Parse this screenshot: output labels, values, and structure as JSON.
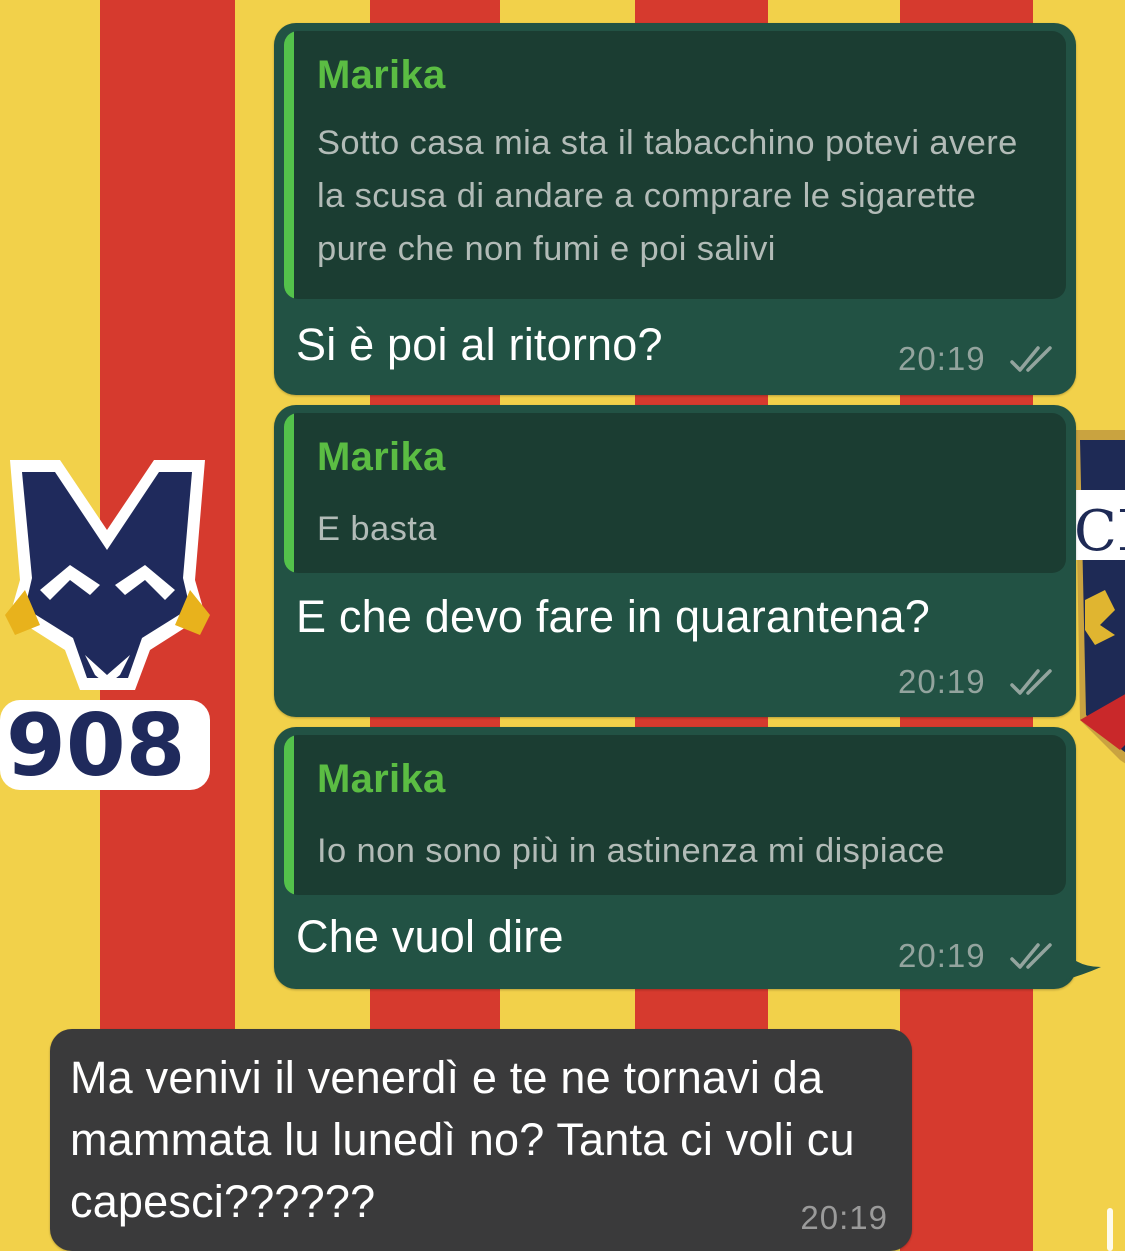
{
  "wallpaper": {
    "stripe_colors": [
      "#f2d14a",
      "#d63a2e"
    ],
    "left_logo_text": "908",
    "right_crest_text": "CE"
  },
  "messages": [
    {
      "direction": "outgoing",
      "quoted": {
        "sender": "Marika",
        "text": "Sotto casa mia sta il tabacchino potevi avere la scusa di andare a comprare le sigarette pure che non fumi e poi salivi"
      },
      "text": "Si è poi al ritorno?",
      "time": "20:19",
      "status": "read-double-check-icon"
    },
    {
      "direction": "outgoing",
      "quoted": {
        "sender": "Marika",
        "text": "E basta"
      },
      "text": "E che devo fare in quarantena?",
      "time": "20:19",
      "status": "read-double-check-icon"
    },
    {
      "direction": "outgoing",
      "quoted": {
        "sender": "Marika",
        "text": "Io non sono più in astinenza mi dispiace"
      },
      "text": "Che vuol dire",
      "time": "20:19",
      "status": "read-double-check-icon"
    },
    {
      "direction": "incoming",
      "text": "Ma venivi il venerdì e te ne tornavi da mammata lu lunedì no? Tanta ci voli cu capesci??????",
      "time": "20:19"
    }
  ],
  "colors": {
    "outgoing_bubble": "#225244",
    "quote_background": "#1b3d32",
    "quote_accent": "#54c24b",
    "quote_sender": "#5bbd43",
    "incoming_bubble": "#3a3a3b"
  }
}
